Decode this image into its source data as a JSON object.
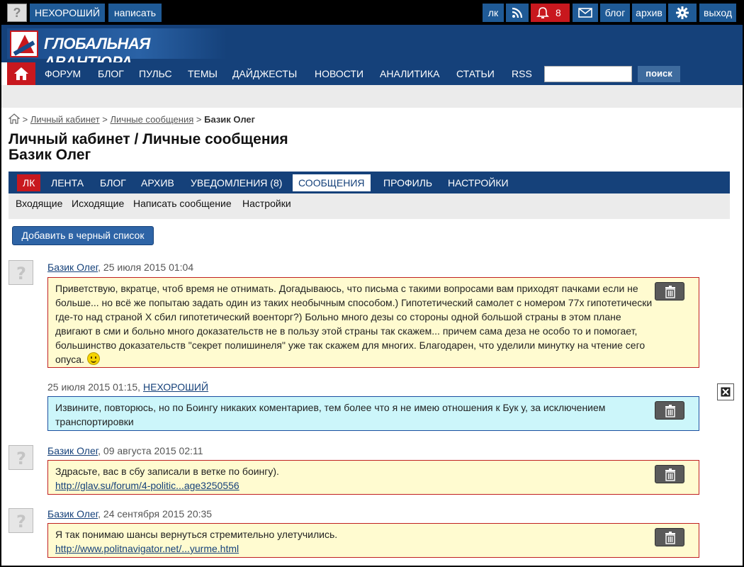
{
  "topbar": {
    "username": "НЕХОРОШИЙ",
    "write_label": "написать",
    "lk_label": "лк",
    "rss_icon": "rss-icon",
    "notifications_count": "8",
    "mail_icon": "mail-icon",
    "blog_label": "блог",
    "archive_label": "архив",
    "settings_icon": "gear-icon",
    "logout_label": "выход"
  },
  "header": {
    "logo_text": "ГЛОБАЛЬНАЯ АВАНТЮРА"
  },
  "nav": {
    "items": [
      "ФОРУМ",
      "БЛОГ",
      "ПУЛЬС",
      "ТЕМЫ",
      "ДАЙДЖЕСТЫ",
      "НОВОСТИ",
      "АНАЛИТИКА",
      "СТАТЬИ",
      "RSS"
    ],
    "search_placeholder": "",
    "search_button": "поиск"
  },
  "breadcrumb": {
    "sep": ">",
    "items": [
      "Личный кабинет",
      "Личные сообщения"
    ],
    "current": "Базик Олег"
  },
  "page_title": {
    "line1": "Личный кабинет / Личные сообщения",
    "line2": "Базик Олег"
  },
  "subnav": {
    "items": [
      "ЛК",
      "ЛЕНТА",
      "БЛОГ",
      "АРХИВ",
      "УВЕДОМЛЕНИЯ (8)",
      "СООБЩЕНИЯ",
      "ПРОФИЛЬ",
      "НАСТРОЙКИ"
    ],
    "active": "СООБЩЕНИЯ"
  },
  "subsub": {
    "items": [
      "Входящие",
      "Исходящие",
      "Написать сообщение",
      "Настройки"
    ]
  },
  "blacklist_button": "Добавить в черный список",
  "messages": [
    {
      "author": "Базик Олег",
      "date": ", 25 июля 2015 01:04",
      "text": "Приветствую, вкратце, чтоб время не отнимать. Догадываюсь, что письма с такими вопросами вам приходят пачками если не больше... но всё же попытаю задать один из таких необычным способом.) Гипотетический самолет с номером 77х гипотетически где-то над страной Х сбил гипотетический военторг?) Больно много дезы со стороны одной большой страны в этом плане двигают в сми и больно много доказательств не в пользу этой страны так скажем... причем сама деза не особо то и помогает, большинство доказательств \"секрет полишинеля\" уже так скажем для многих. Благодарен, что уделили минутку на чтение сего опуса."
    },
    {
      "date": "25 июля 2015 01:15, ",
      "author": "НЕХОРОШИЙ",
      "text": "Извините, повторюсь, но по Боингу никаких коментариев, тем более что я не имею отношения к Бук у, за исключением транспортировки"
    },
    {
      "author": "Базик Олег",
      "date": ", 09 августа 2015 02:11",
      "text": "Здрасьте, вас в сбу записали в ветке по боингу).",
      "link": "http://glav.su/forum/4-politic...age3250556"
    },
    {
      "author": "Базик Олег",
      "date": ", 24 сентября 2015 20:35",
      "text": "Я так понимаю шансы вернуться стремительно улетучились.",
      "link": "http://www.politnavigator.net/...yurme.html"
    }
  ]
}
